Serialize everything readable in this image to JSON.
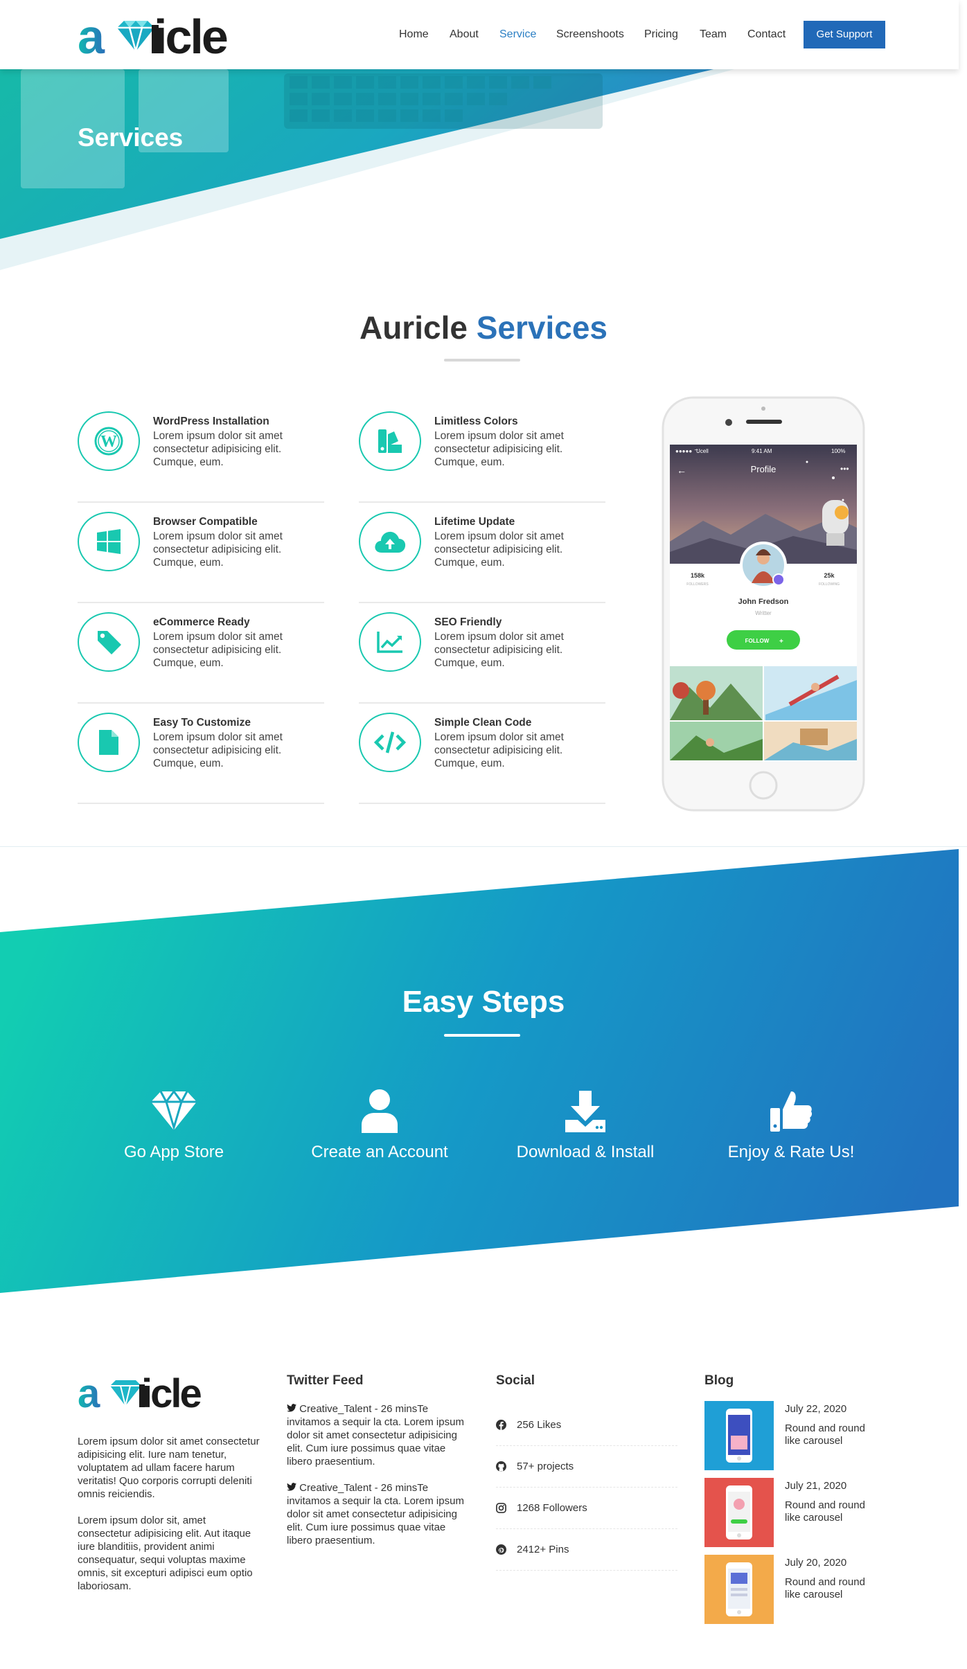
{
  "brand": {
    "name": "auricle",
    "logo_icon": "diamond-icon"
  },
  "nav": {
    "items": [
      "Home",
      "About",
      "Service",
      "Screenshoots",
      "Pricing",
      "Team",
      "Contact"
    ],
    "active": "Service",
    "support_label": "Get Support"
  },
  "hero": {
    "title": "Services"
  },
  "services": {
    "title_main": "Auricle",
    "title_accent": "Services",
    "items": [
      {
        "name": "WordPress Installation",
        "desc": "Lorem ipsum dolor sit amet consectetur adipisicing elit. Cumque, eum.",
        "icon": "wordpress-icon"
      },
      {
        "name": "Limitless Colors",
        "desc": "Lorem ipsum dolor sit amet consectetur adipisicing elit. Cumque, eum.",
        "icon": "swatches-icon"
      },
      {
        "name": "Browser Compatible",
        "desc": "Lorem ipsum dolor sit amet consectetur adipisicing elit. Cumque, eum.",
        "icon": "windows-icon"
      },
      {
        "name": "Lifetime Update",
        "desc": "Lorem ipsum dolor sit amet consectetur adipisicing elit. Cumque, eum.",
        "icon": "cloud-upload-icon"
      },
      {
        "name": "eCommerce Ready",
        "desc": "Lorem ipsum dolor sit amet consectetur adipisicing elit. Cumque, eum.",
        "icon": "tag-icon"
      },
      {
        "name": "SEO Friendly",
        "desc": "Lorem ipsum dolor sit amet consectetur adipisicing elit. Cumque, eum.",
        "icon": "chart-line-icon"
      },
      {
        "name": "Easy To Customize",
        "desc": "Lorem ipsum dolor sit amet consectetur adipisicing elit. Cumque, eum.",
        "icon": "file-icon"
      },
      {
        "name": "Simple Clean Code",
        "desc": "Lorem ipsum dolor sit amet consectetur adipisicing elit. Cumque, eum.",
        "icon": "code-icon"
      }
    ]
  },
  "phone": {
    "status_carrier": "Ucell",
    "status_time": "9:41 AM",
    "status_battery": "100%",
    "screen_title": "Profile",
    "followers_count": "158k",
    "followers_label": "FOLLOWERS",
    "following_count": "25k",
    "following_label": "FOLLOWING",
    "profile_name": "John Fredson",
    "profile_role": "Writter",
    "follow_label": "FOLLOW"
  },
  "steps": {
    "title": "Easy Steps",
    "items": [
      {
        "label": "Go App Store",
        "icon": "diamond-icon"
      },
      {
        "label": "Create an Account",
        "icon": "user-icon"
      },
      {
        "label": "Download & Install",
        "icon": "download-icon"
      },
      {
        "label": "Enjoy & Rate Us!",
        "icon": "thumbs-up-icon"
      }
    ]
  },
  "footer": {
    "about_p1": "Lorem ipsum dolor sit amet consectetur adipisicing elit. Iure nam tenetur, voluptatem ad ullam facere harum veritatis! Quo corporis corrupti deleniti omnis reiciendis.",
    "about_p2": "Lorem ipsum dolor sit, amet consectetur adipisicing elit. Aut itaque iure blanditiis, provident animi consequatur, sequi voluptas maxime omnis, sit excepturi adipisci eum optio laboriosam.",
    "twitter_title": "Twitter Feed",
    "tweets": [
      "Creative_Talent - 26 minsTe invitamos a sequir la cta. Lorem ipsum dolor sit amet consectetur adipisicing elit. Cum iure possimus quae vitae libero praesentium.",
      "Creative_Talent - 26 minsTe invitamos a sequir la cta. Lorem ipsum dolor sit amet consectetur adipisicing elit. Cum iure possimus quae vitae libero praesentium."
    ],
    "social_title": "Social",
    "social": [
      {
        "label": "256 Likes",
        "icon": "facebook-icon"
      },
      {
        "label": "57+ projects",
        "icon": "github-icon"
      },
      {
        "label": "1268 Followers",
        "icon": "instagram-icon"
      },
      {
        "label": "2412+ Pins",
        "icon": "pinterest-icon"
      }
    ],
    "blog_title": "Blog",
    "blog": [
      {
        "date": "July 22, 2020",
        "title": "Round and round like carousel",
        "color": "#1f9fd6"
      },
      {
        "date": "July 21, 2020",
        "title": "Round and round like carousel",
        "color": "#e4534c"
      },
      {
        "date": "July 20, 2020",
        "title": "Round and round like carousel",
        "color": "#f3aa4a"
      }
    ]
  },
  "colors": {
    "accent": "#19c8b0",
    "brand_blue": "#2169b8",
    "teal": "#12cfb3",
    "blue": "#2169c0"
  }
}
